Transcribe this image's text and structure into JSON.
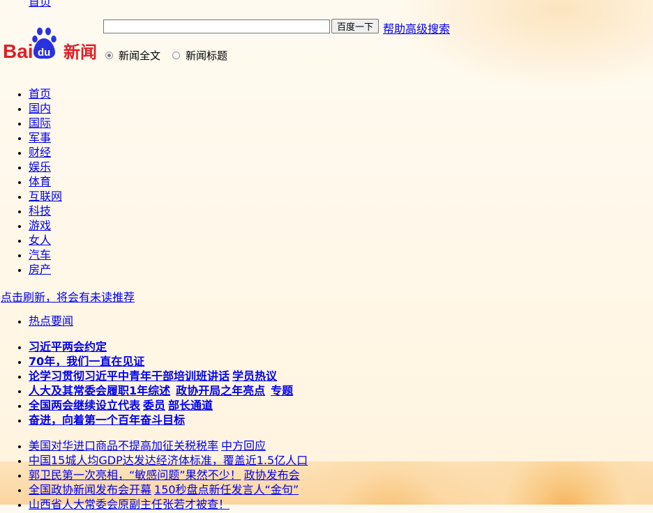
{
  "top_cut": "首页",
  "logo": {
    "text_bai": "Bai",
    "text_du": "du",
    "text_news": "新闻"
  },
  "search": {
    "value": "",
    "placeholder": "",
    "button_label": "百度一下",
    "help_link": "帮助",
    "advanced_link": "高级搜索",
    "options": [
      {
        "label": "新闻全文",
        "checked": true
      },
      {
        "label": "新闻标题",
        "checked": false
      }
    ]
  },
  "nav": {
    "items": [
      "首页",
      "国内",
      "国际",
      "军事",
      "财经",
      "娱乐",
      "体育",
      "互联网",
      "科技",
      "游戏",
      "女人",
      "汽车",
      "房产"
    ]
  },
  "refresh_link": "点击刷新，将会有未读推荐",
  "hot_tab": "热点要闻",
  "headlines": [
    {
      "parts": [
        "习近平两会约定"
      ]
    },
    {
      "parts": [
        "70年，我们一直在见证"
      ]
    },
    {
      "parts": [
        "论学习贯彻习近平中青年干部培训班讲话",
        "学员热议"
      ]
    },
    {
      "parts": [
        "人大及其常委会履职1年综述",
        "政协开局之年亮点",
        "专题"
      ]
    },
    {
      "parts": [
        "全国两会继续设立代表",
        "委员",
        "部长通道"
      ]
    },
    {
      "parts": [
        "奋进，向着第一个百年奋斗目标"
      ]
    }
  ],
  "news": [
    {
      "parts": [
        "美国对华进口商品不提高加征关税税率",
        "中方回应"
      ]
    },
    {
      "parts": [
        "中国15城人均GDP达发达经济体标准，覆盖近1.5亿人口"
      ]
    },
    {
      "parts": [
        "郭卫民第一次亮相，“敏感问题”果然不少！",
        "政协发布会"
      ]
    },
    {
      "parts": [
        "全国政协新闻发布会开幕",
        "150秒盘点新任发言人“金句”"
      ]
    },
    {
      "parts": [
        "山西省人大常委会原副主任张若才被查！"
      ]
    }
  ],
  "colors": {
    "link": "#0000ee",
    "logo_red": "#de1f26",
    "logo_blue": "#2932e1"
  }
}
